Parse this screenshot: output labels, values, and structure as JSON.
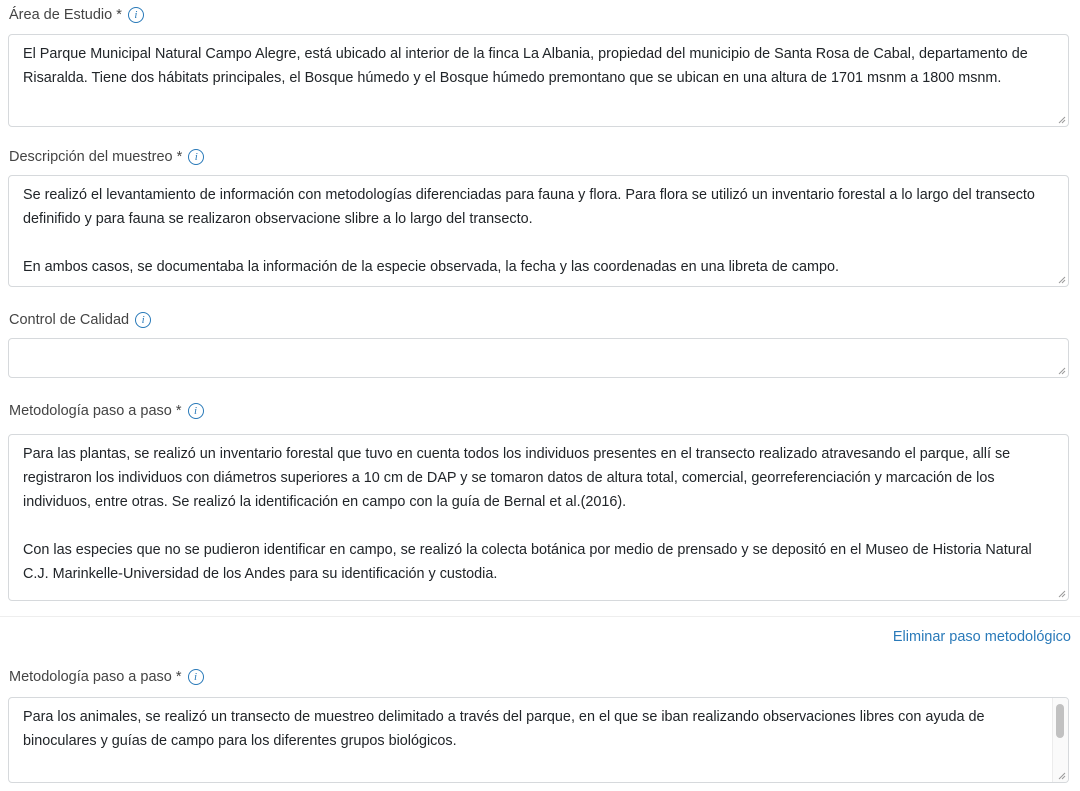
{
  "fields": {
    "area": {
      "label": "Área de Estudio *",
      "paragraphs": [
        "El Parque Municipal Natural Campo Alegre, está ubicado al interior de la finca La Albania, propiedad del municipio de Santa Rosa de Cabal, departamento de Risaralda. Tiene dos hábitats principales, el Bosque húmedo y el Bosque húmedo premontano que se ubican en una altura de 1701 msnm a 1800 msnm."
      ]
    },
    "sampling": {
      "label": "Descripción del muestreo *",
      "paragraphs": [
        "Se realizó el levantamiento de información con metodologías diferenciadas para fauna y flora. Para flora se utilizó un inventario forestal a lo largo del transecto definifido y para fauna se realizaron observacione slibre a lo largo del transecto.",
        "En ambos casos, se documentaba la información de la especie observada, la fecha y las coordenadas en una libreta de campo."
      ]
    },
    "quality": {
      "label": "Control de Calidad",
      "value": ""
    },
    "method1": {
      "label": "Metodología paso a paso *",
      "paragraphs": [
        "Para las plantas, se realizó un inventario forestal que tuvo en cuenta todos los individuos presentes en el transecto realizado atravesando el parque, allí se registraron los individuos con diámetros superiores a 10 cm de DAP y se tomaron datos de altura total, comercial, georreferenciación y marcación de los individuos, entre otras. Se realizó la identificación en campo con la guía de Bernal et al.(2016).",
        "Con las especies que no se pudieron identificar en campo, se realizó la colecta botánica por medio de prensado y se depositó en el Museo de Historia Natural C.J. Marinkelle-Universidad de los Andes para su identificación y custodia."
      ]
    },
    "method2": {
      "label": "Metodología paso a paso *",
      "paragraphs": [
        "Para los animales, se realizó un transecto de muestreo delimitado a través del parque, en el que se iban realizando observaciones libres con ayuda de binoculares y guías de campo para los diferentes grupos biológicos."
      ]
    }
  },
  "actions": {
    "remove_step": "Eliminar paso metodológico"
  },
  "info_icon_glyph": "i",
  "colors": {
    "link": "#2a7ab9",
    "border": "#d6d9dc",
    "label": "#444444"
  }
}
